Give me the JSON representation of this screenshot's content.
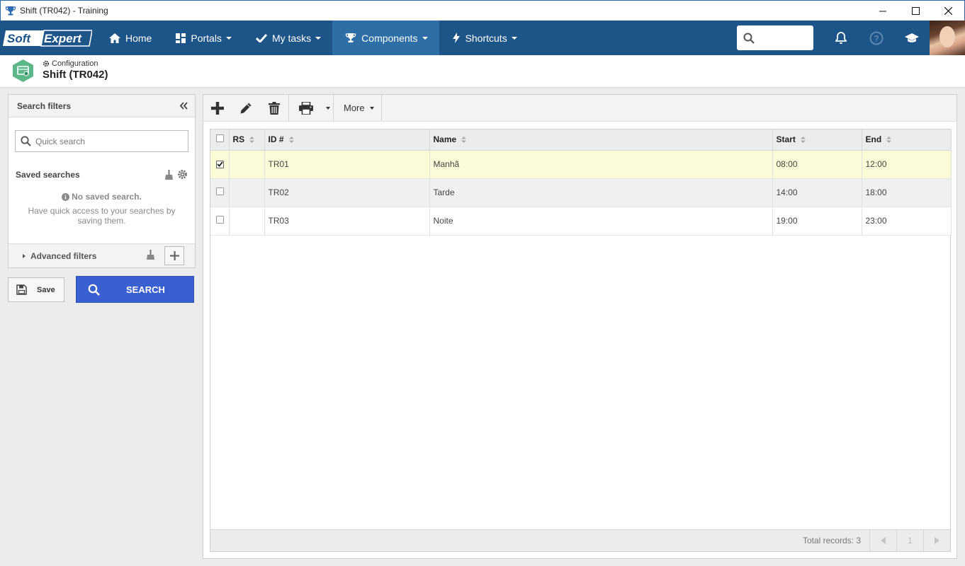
{
  "window": {
    "title": "Shift (TR042) - Training",
    "icon": "trophy-icon"
  },
  "nav": {
    "logo_text": "SoftExpert",
    "items": [
      {
        "label": "Home",
        "icon": "home-icon",
        "has_caret": false
      },
      {
        "label": "Portals",
        "icon": "portals-icon",
        "has_caret": true
      },
      {
        "label": "My tasks",
        "icon": "checkmark-icon",
        "has_caret": true
      },
      {
        "label": "Components",
        "icon": "trophy-icon",
        "has_caret": true,
        "active": true
      },
      {
        "label": "Shortcuts",
        "icon": "bolt-icon",
        "has_caret": true
      }
    ],
    "search_placeholder": "",
    "accent_color": "#1e5589",
    "active_color": "#2e6ea6"
  },
  "header": {
    "breadcrumb": "Configuration",
    "title": "Shift (TR042)"
  },
  "filters": {
    "title": "Search filters",
    "quick_search_placeholder": "Quick search",
    "saved_searches_label": "Saved searches",
    "no_saved_title": "No saved search.",
    "no_saved_hint": "Have quick access to your searches by saving them.",
    "advanced_label": "Advanced filters",
    "save_label": "Save",
    "search_label": "SEARCH",
    "search_color": "#3a5fd0"
  },
  "toolbar": {
    "more_label": "More"
  },
  "grid": {
    "columns": [
      "RS",
      "ID #",
      "Name",
      "Start",
      "End"
    ],
    "rows": [
      {
        "checked": true,
        "rs": "",
        "id": "TR01",
        "name": "Manhã",
        "start": "08:00",
        "end": "12:00"
      },
      {
        "checked": false,
        "rs": "",
        "id": "TR02",
        "name": "Tarde",
        "start": "14:00",
        "end": "18:00"
      },
      {
        "checked": false,
        "rs": "",
        "id": "TR03",
        "name": "Noite",
        "start": "19:00",
        "end": "23:00"
      }
    ],
    "total_records": "Total records: 3",
    "page": "1",
    "selected_row_color": "#fbfbd7"
  }
}
